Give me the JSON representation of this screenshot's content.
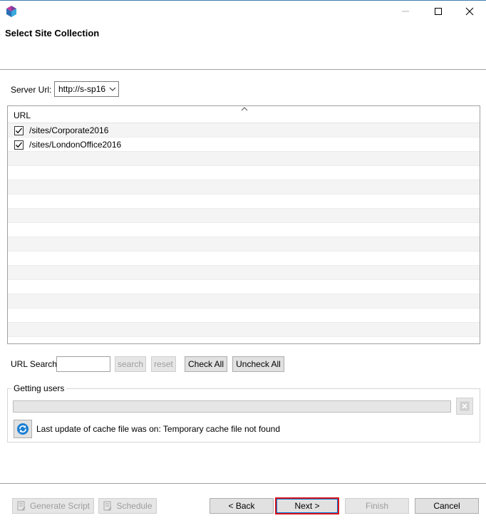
{
  "window": {
    "title": "Select Site Collection"
  },
  "server": {
    "label": "Server Url:",
    "value": "http://s-sp16"
  },
  "url_list": {
    "column_header": "URL",
    "rows": [
      {
        "url": "/sites/Corporate2016",
        "checked": true
      },
      {
        "url": "/sites/LondonOffice2016",
        "checked": true
      }
    ]
  },
  "search": {
    "label": "URL Search",
    "value": "",
    "search_label": "search",
    "reset_label": "reset",
    "check_all_label": "Check All",
    "uncheck_all_label": "Uncheck All"
  },
  "progress_group": {
    "title": "Getting users",
    "progress": 0,
    "cache_message": "Last update of cache file was on: Temporary cache file not found"
  },
  "footer": {
    "generate_script_label": "Generate Script",
    "schedule_label": "Schedule",
    "back_label": "< Back",
    "next_label": "Next >",
    "finish_label": "Finish",
    "cancel_label": "Cancel"
  },
  "colors": {
    "accent": "#0078d7",
    "highlight_border": "#d9141b",
    "window_border": "#3c7fb1"
  }
}
